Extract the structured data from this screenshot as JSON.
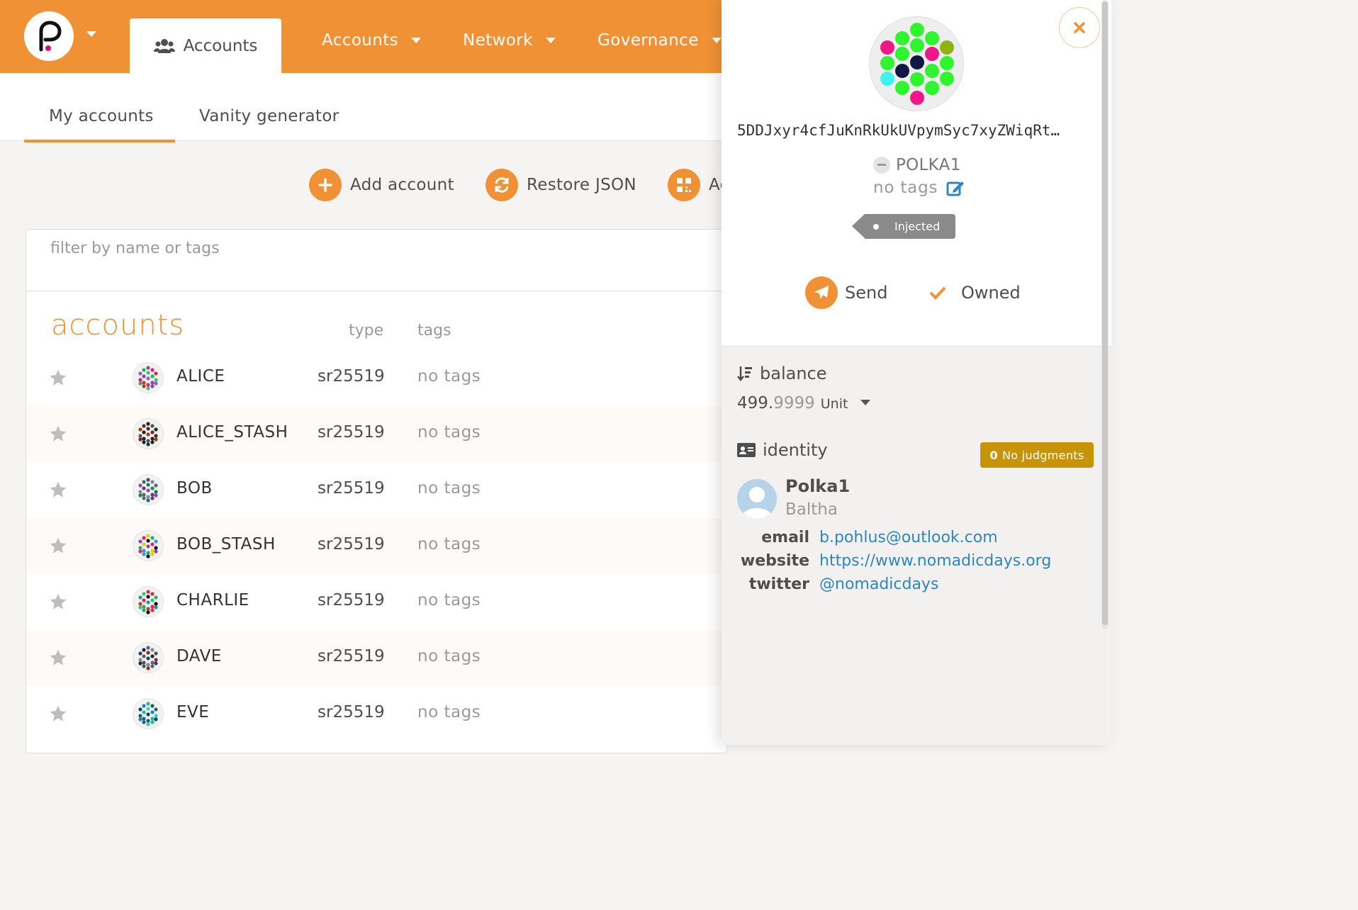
{
  "header": {
    "active_tab": "Accounts",
    "nav": [
      "Accounts",
      "Network",
      "Governance"
    ]
  },
  "subtabs": [
    "My accounts",
    "Vanity generator"
  ],
  "actions": {
    "add_account": "Add account",
    "restore_json": "Restore JSON",
    "add_via_qr_partial": "Ac"
  },
  "filter": {
    "placeholder": "filter by name or tags"
  },
  "accounts": {
    "title": "accounts",
    "col_type": "type",
    "col_tags": "tags",
    "rows": [
      {
        "name": "ALICE",
        "type": "sr25519",
        "tags": "no tags",
        "colors": [
          "#8e44ad",
          "#27ae60",
          "#e91e63",
          "#9b59b6",
          "#2ecc71",
          "#c0392b"
        ]
      },
      {
        "name": "ALICE_STASH",
        "type": "sr25519",
        "tags": "no tags",
        "colors": [
          "#222222",
          "#7b241c",
          "#555555",
          "#a04000",
          "#333333",
          "#1b2631"
        ]
      },
      {
        "name": "BOB",
        "type": "sr25519",
        "tags": "no tags",
        "colors": [
          "#6c3483",
          "#1e8449",
          "#7f8c8d",
          "#884ea0",
          "#117864",
          "#566573"
        ]
      },
      {
        "name": "BOB_STASH",
        "type": "sr25519",
        "tags": "no tags",
        "colors": [
          "#f1c40f",
          "#e91e63",
          "#27ae60",
          "#8e44ad",
          "#111111",
          "#3498db"
        ]
      },
      {
        "name": "CHARLIE",
        "type": "sr25519",
        "tags": "no tags",
        "colors": [
          "#e91e63",
          "#2ecc71",
          "#c0392b",
          "#16a085",
          "#111111",
          "#27ae60"
        ]
      },
      {
        "name": "DAVE",
        "type": "sr25519",
        "tags": "no tags",
        "colors": [
          "#566573",
          "#1c2833",
          "#7f8c8d",
          "#2e4053",
          "#922b21",
          "#4d5656"
        ]
      },
      {
        "name": "EVE",
        "type": "sr25519",
        "tags": "no tags",
        "colors": [
          "#1abc9c",
          "#2980b9",
          "#0e6655",
          "#154360",
          "#48c9b0",
          "#1f618d"
        ]
      }
    ]
  },
  "sidebar": {
    "address": "5DDJxyr4cfJuKnRkUkUVpymSyc7xyZWiqRt…",
    "name": "POLKA1",
    "tags": "no tags",
    "badge": "Injected",
    "send": "Send",
    "owned": "Owned",
    "balance_label": "balance",
    "balance_int": "499.",
    "balance_dec": "9999",
    "balance_unit": "Unit",
    "identity_label": "identity",
    "judgments_count": "0",
    "judgments_text": "No judgments",
    "id_display": "Polka1",
    "id_legal": "Baltha",
    "fields": [
      {
        "key": "email",
        "value": "b.pohlus@outlook.com"
      },
      {
        "key": "website",
        "value": "https://www.nomadicdays.org"
      },
      {
        "key": "twitter",
        "value": "@nomadicdays"
      }
    ],
    "identicon_colors": [
      "#2ff52f",
      "#f01886",
      "#111844",
      "#8fb312",
      "#3ef3e9"
    ]
  },
  "colors": {
    "accent": "#f19135",
    "link": "#2c87be",
    "judgment": "#c79407"
  }
}
